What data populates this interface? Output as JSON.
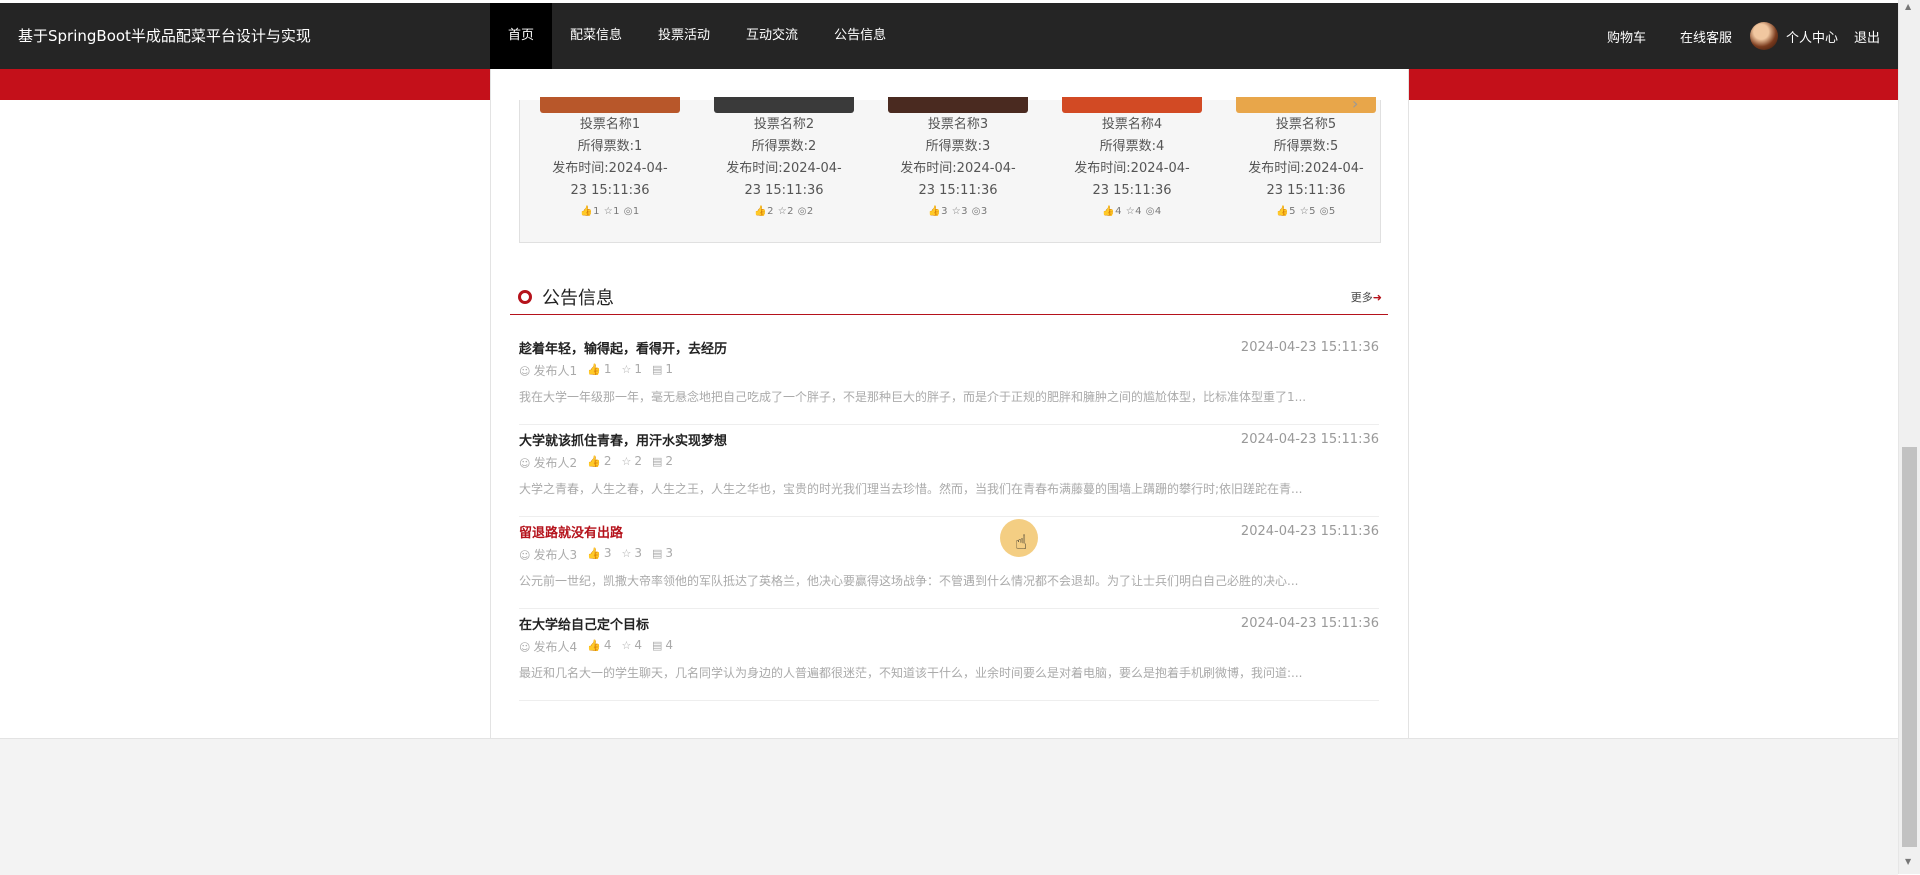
{
  "header": {
    "site_title": "基于SpringBoot半成品配菜平台设计与实现",
    "nav": [
      "首页",
      "配菜信息",
      "投票活动",
      "互动交流",
      "公告信息"
    ],
    "active_nav": "首页",
    "right": {
      "cart": "购物车",
      "support": "在线客服",
      "user_center": "个人中心",
      "logout": "退出"
    }
  },
  "votes": [
    {
      "name": "投票名称1",
      "count": "所得票数:1",
      "time": "发布时间:2024-04-23 15:11:36",
      "stats": "👍1 ☆1 ◎1",
      "img_color": "#b8572a"
    },
    {
      "name": "投票名称2",
      "count": "所得票数:2",
      "time": "发布时间:2024-04-23 15:11:36",
      "stats": "👍2 ☆2 ◎2",
      "img_color": "#3a3a3a"
    },
    {
      "name": "投票名称3",
      "count": "所得票数:3",
      "time": "发布时间:2024-04-23 15:11:36",
      "stats": "👍3 ☆3 ◎3",
      "img_color": "#4a2a20"
    },
    {
      "name": "投票名称4",
      "count": "所得票数:4",
      "time": "发布时间:2024-04-23 15:11:36",
      "stats": "👍4 ☆4 ◎4",
      "img_color": "#d24a24"
    },
    {
      "name": "投票名称5",
      "count": "所得票数:5",
      "time": "发布时间:2024-04-23 15:11:36",
      "stats": "👍5 ☆5 ◎5",
      "img_color": "#e8a64a"
    }
  ],
  "notice": {
    "title": "公告信息",
    "more": "更多",
    "items": [
      {
        "title": "趁着年轻，输得起，看得开，去经历",
        "time": "2024-04-23 15:11:36",
        "author": "发布人1",
        "likes": "1",
        "favs": "1",
        "comments": "1",
        "desc": "我在大学一年级那一年，毫无悬念地把自己吃成了一个胖子，不是那种巨大的胖子，而是介于正规的肥胖和臃肿之间的尴尬体型，比标准体型重了1..."
      },
      {
        "title": "大学就该抓住青春，用汗水实现梦想",
        "time": "2024-04-23 15:11:36",
        "author": "发布人2",
        "likes": "2",
        "favs": "2",
        "comments": "2",
        "desc": "大学之青春，人生之春，人生之王，人生之华也，宝贵的时光我们理当去珍惜。然而，当我们在青春布满藤蔓的围墙上蹒跚的攀行时;依旧蹉跎在青..."
      },
      {
        "title": "留退路就没有出路",
        "time": "2024-04-23 15:11:36",
        "author": "发布人3",
        "likes": "3",
        "favs": "3",
        "comments": "3",
        "desc": "公元前一世纪，凯撒大帝率领他的军队抵达了英格兰，他决心要赢得这场战争：不管遇到什么情况都不会退却。为了让士兵们明白自己必胜的决心..."
      },
      {
        "title": "在大学给自己定个目标",
        "time": "2024-04-23 15:11:36",
        "author": "发布人4",
        "likes": "4",
        "favs": "4",
        "comments": "4",
        "desc": "最近和几名大一的学生聊天，几名同学认为身边的人普遍都很迷茫，不知道该干什么，业余时间要么是对着电脑，要么是抱着手机刷微博，我问道:..."
      }
    ]
  },
  "colors": {
    "brand_red": "#c4101a",
    "nav_bg": "#252525"
  }
}
